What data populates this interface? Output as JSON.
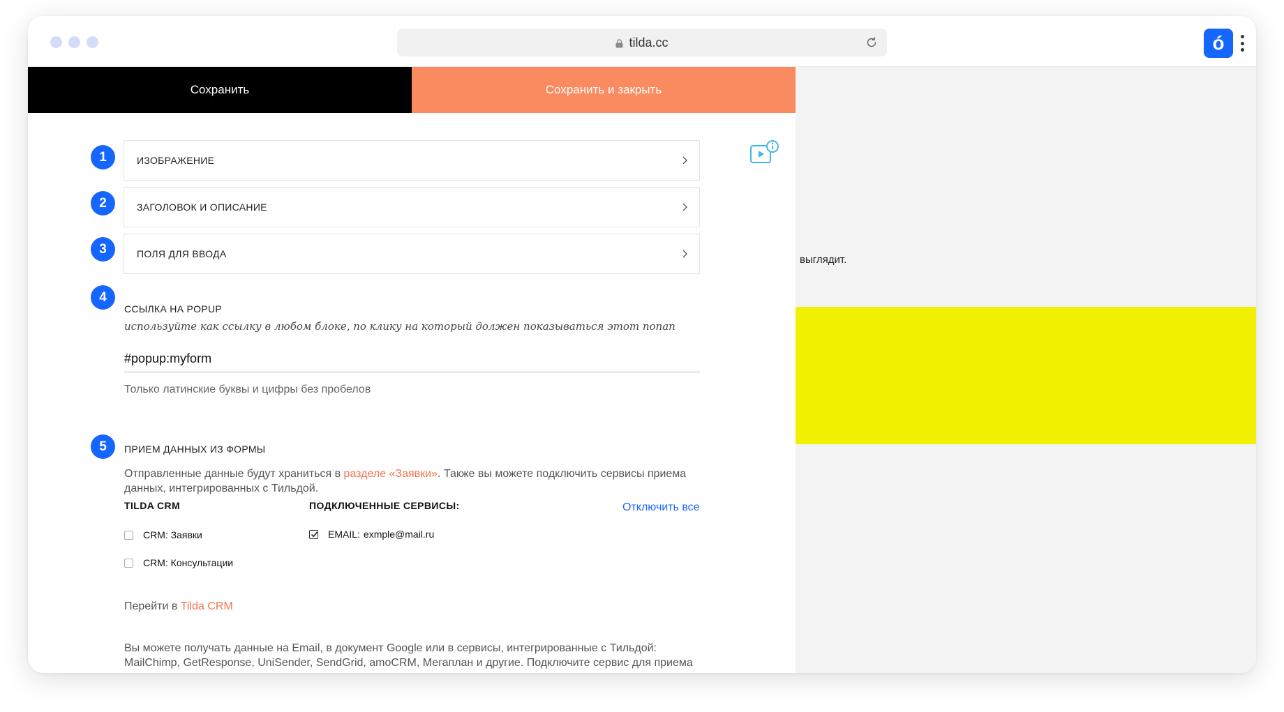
{
  "browser": {
    "url": "tilda.cc",
    "brand_letter": "ó",
    "icons": [
      "lock-icon",
      "reload-icon",
      "kebab-menu-icon"
    ]
  },
  "toolbar": {
    "save_label": "Сохранить",
    "save_close_label": "Сохранить и закрыть"
  },
  "sections": {
    "numbers": [
      "1",
      "2",
      "3",
      "4",
      "5"
    ],
    "image_label": "ИЗОБРАЖЕНИЕ",
    "heading_label": "ЗАГОЛОВОК И ОПИСАНИЕ",
    "fields_label": "ПОЛЯ ДЛЯ ВВОДА"
  },
  "popup_link": {
    "title": "ССЫЛКА НА POPUP",
    "hint": "используйте как ссылку в любом блоке, по клику на который должен показываться этот попап",
    "value": "#popup:myform",
    "note": "Только латинские буквы и цифры без пробелов"
  },
  "form_data": {
    "title": "ПРИЕМ ДАННЫХ ИЗ ФОРМЫ",
    "intro_before": "Отправленные данные будут храниться в ",
    "intro_link": "разделе «Заявки»",
    "intro_after": ". Также вы можете подключить сервисы приема данных, интегрированных с Тильдой.",
    "crm_header": "TILDA CRM",
    "services_header": "ПОДКЛЮЧЕННЫЕ СЕРВИСЫ:",
    "disconnect_all": "Отключить все",
    "crm_options": [
      {
        "label": "CRM: Заявки",
        "checked": false
      },
      {
        "label": "CRM: Консультации",
        "checked": false
      }
    ],
    "service": {
      "prefix": "EMAIL:",
      "value": "exmple@mail.ru",
      "checked": true
    },
    "goto_prefix": "Перейти в ",
    "goto_link": "Tilda CRM",
    "bottom_text": "Вы можете получать данные на Email, в документ Google или в сервисы, интегрированные с Тильдой: MailChimp, GetResponse, UniSender, SendGrid, amoCRM, Мегаплан и другие. Подключите сервис для приема"
  },
  "preview": {
    "text": "выглядит.",
    "block_color": "#f0f000"
  },
  "colors": {
    "accent_blue": "#1565ff",
    "accent_orange": "#fa8a60",
    "link_orange": "#f4734c"
  }
}
